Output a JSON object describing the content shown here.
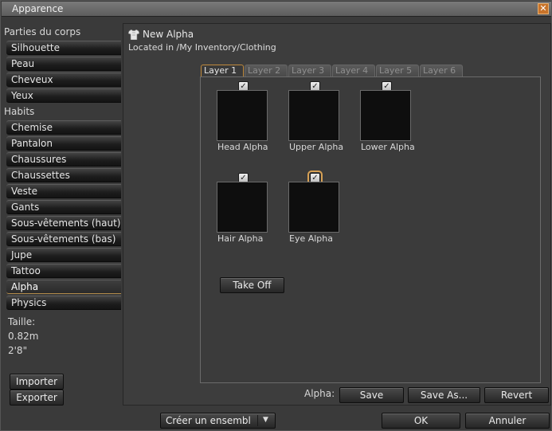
{
  "window": {
    "title": "Apparence",
    "close_glyph": "✕"
  },
  "sidebar": {
    "body_parts_label": "Parties du corps",
    "body_parts": [
      {
        "label": "Silhouette"
      },
      {
        "label": "Peau"
      },
      {
        "label": "Cheveux"
      },
      {
        "label": "Yeux"
      }
    ],
    "clothes_label": "Habits",
    "clothes": [
      {
        "label": "Chemise"
      },
      {
        "label": "Pantalon"
      },
      {
        "label": "Chaussures"
      },
      {
        "label": "Chaussettes"
      },
      {
        "label": "Veste"
      },
      {
        "label": "Gants"
      },
      {
        "label": "Sous-vêtements (haut)"
      },
      {
        "label": "Sous-vêtements (bas)"
      },
      {
        "label": "Jupe"
      },
      {
        "label": "Tattoo"
      },
      {
        "label": "Alpha",
        "selected": true
      },
      {
        "label": "Physics"
      }
    ],
    "size_label": "Taille:",
    "size_metric": "0.82m",
    "size_imperial": "2'8\"",
    "import_label": "Importer",
    "export_label": "Exporter"
  },
  "item": {
    "icon": "shirt-icon",
    "name": "New Alpha",
    "location": "Located in /My Inventory/Clothing"
  },
  "tabs": [
    {
      "label": "Layer 1",
      "active": true
    },
    {
      "label": "Layer 2"
    },
    {
      "label": "Layer 3"
    },
    {
      "label": "Layer 4"
    },
    {
      "label": "Layer 5"
    },
    {
      "label": "Layer 6"
    }
  ],
  "alphas": [
    {
      "label": "Head Alpha",
      "checked": true
    },
    {
      "label": "Upper Alpha",
      "checked": true
    },
    {
      "label": "Lower Alpha",
      "checked": true
    },
    {
      "label": "Hair Alpha",
      "checked": true
    },
    {
      "label": "Eye Alpha",
      "checked": true,
      "focused": true
    }
  ],
  "take_off_label": "Take Off",
  "footer": {
    "alpha_label": "Alpha:",
    "save_label": "Save",
    "save_as_label": "Save As...",
    "revert_label": "Revert",
    "outfit_dropdown_label": "Créer un ensembl",
    "ok_label": "OK",
    "cancel_label": "Annuler"
  },
  "colors": {
    "accent": "#c08a3c",
    "swatch": "#0e0e0e"
  }
}
